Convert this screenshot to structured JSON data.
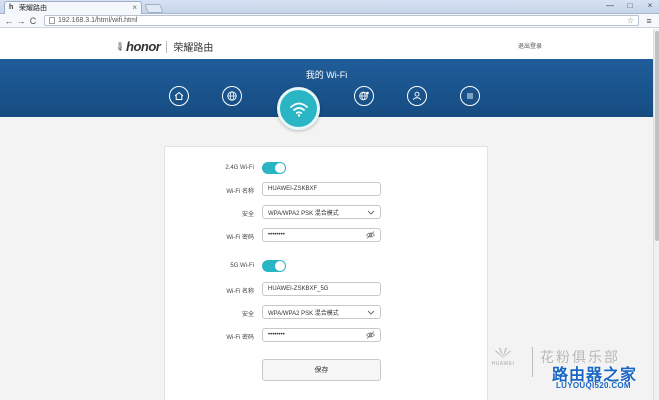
{
  "browser": {
    "tab_favicon": "h",
    "tab_title": "荣耀路由",
    "tab_close": "×",
    "url": "192.168.3.1/html/wifi.html",
    "back_glyph": "←",
    "forward_glyph": "→",
    "reload_glyph": "C",
    "star_glyph": "☆",
    "menu_glyph": "≡",
    "win_min": "—",
    "win_max": "□",
    "win_close": "×"
  },
  "header": {
    "logo_mark": "荣耀",
    "logo_word": "honor",
    "logo_cn": "荣耀路由",
    "logout": "退出登录"
  },
  "band": {
    "title": "我的 Wi-Fi",
    "nav_icons": [
      "home-icon",
      "globe-icon",
      "wifi-icon",
      "internet-settings-icon",
      "user-icon",
      "menu-icon"
    ]
  },
  "wifi24": {
    "section_label": "2.4G Wi-Fi",
    "enabled": true,
    "name_label": "Wi-Fi 名称",
    "name_value": "HUAWEI-ZSKBXF",
    "security_label": "安全",
    "security_value": "WPA/WPA2 PSK 混合模式",
    "password_label": "Wi-Fi 密码",
    "password_value": "••••••••"
  },
  "wifi5": {
    "section_label": "5G Wi-Fi",
    "enabled": true,
    "name_label": "Wi-Fi 名称",
    "name_value": "HUAWEI-ZSKBXF_5G",
    "security_label": "安全",
    "security_value": "WPA/WPA2 PSK 混合模式",
    "password_label": "Wi-Fi 密码",
    "password_value": "••••••••"
  },
  "actions": {
    "save_label": "保存"
  },
  "watermark": {
    "huawei_text": "HUAWEI",
    "cn_text": "花粉俱乐部",
    "site_text": "路由器之家",
    "url_text": "LUYOUQI520.COM"
  },
  "colors": {
    "band_blue": "#1f5d9a",
    "accent_teal": "#2ab5c4",
    "watermark_blue": "#1a66c4"
  }
}
